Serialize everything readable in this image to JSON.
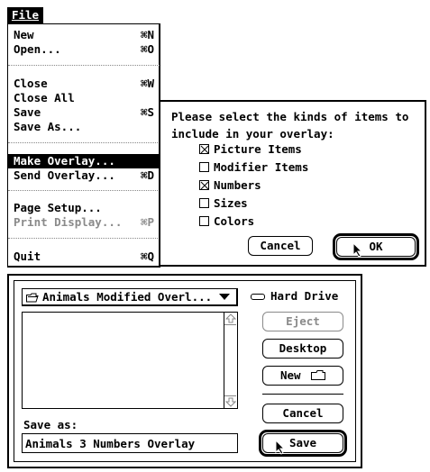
{
  "menubar": {
    "file_label": "File"
  },
  "file_menu": {
    "items": [
      {
        "label": "New",
        "shortcut": "⌘N"
      },
      {
        "label": "Open...",
        "shortcut": "⌘O"
      },
      {
        "label": "Close",
        "shortcut": "⌘W"
      },
      {
        "label": "Close All",
        "shortcut": ""
      },
      {
        "label": "Save",
        "shortcut": "⌘S"
      },
      {
        "label": "Save As...",
        "shortcut": ""
      },
      {
        "label": "Make Overlay...",
        "shortcut": ""
      },
      {
        "label": "Send Overlay...",
        "shortcut": "⌘D"
      },
      {
        "label": "Page Setup...",
        "shortcut": ""
      },
      {
        "label": "Print Display...",
        "shortcut": "⌘P"
      },
      {
        "label": "Quit",
        "shortcut": "⌘Q"
      }
    ]
  },
  "overlay_dialog": {
    "prompt_line1": "Please select the kinds of items to",
    "prompt_line2": "include in your overlay:",
    "options": [
      {
        "label": "Picture Items",
        "checked": true
      },
      {
        "label": "Modifier Items",
        "checked": false
      },
      {
        "label": "Numbers",
        "checked": true
      },
      {
        "label": "Sizes",
        "checked": false
      },
      {
        "label": "Colors",
        "checked": false
      }
    ],
    "cancel_label": "Cancel",
    "ok_label": "OK"
  },
  "save_dialog": {
    "folder_popup": "Animals Modified Overl...",
    "drive_label": "Hard Drive",
    "eject_label": "Eject",
    "desktop_label": "Desktop",
    "new_label": "New",
    "cancel_label": "Cancel",
    "save_label": "Save",
    "save_as_label": "Save as:",
    "filename_value": "Animals 3 Numbers Overlay"
  }
}
